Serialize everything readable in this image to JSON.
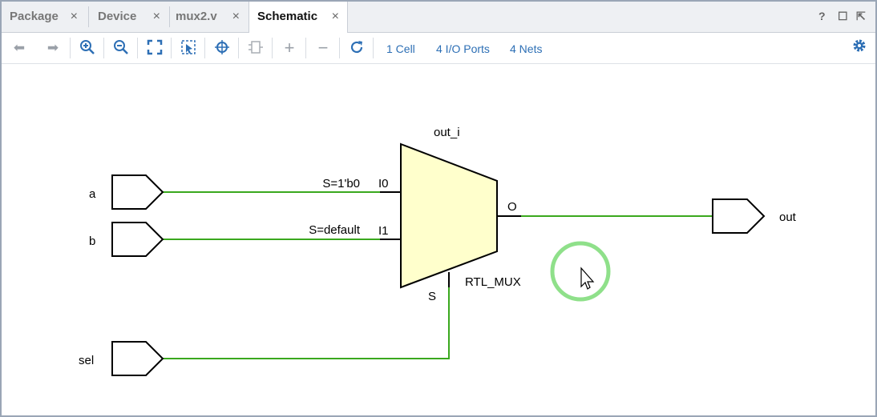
{
  "tabs": [
    {
      "label": "Package",
      "close": "×"
    },
    {
      "label": "Device",
      "close": "×"
    },
    {
      "label": "mux2.v",
      "close": "×"
    },
    {
      "label": "Schematic",
      "close": "×"
    }
  ],
  "active_tab": "Schematic",
  "window_controls": {
    "help": "?",
    "restore": "☐",
    "float": "⇱"
  },
  "toolbar": {
    "icons": [
      "back-arrow-icon",
      "forward-arrow-icon",
      "zoom-in-icon",
      "zoom-out-icon",
      "fit-view-icon",
      "zoom-area-icon",
      "select-icon",
      "autoroute-icon",
      "expand-icon",
      "collapse-icon",
      "refresh-icon"
    ],
    "cells": "1 Cell",
    "io_ports": "4 I/O Ports",
    "nets": "4 Nets"
  },
  "schematic": {
    "instance_name": "out_i",
    "cell_type": "RTL_MUX",
    "pins": {
      "i0": "I0",
      "i1": "I1",
      "o": "O",
      "s": "S"
    },
    "conditions": {
      "i0": "S=1'b0",
      "i1": "S=default"
    },
    "ports": {
      "a": "a",
      "b": "b",
      "sel": "sel",
      "out": "out"
    },
    "colors": {
      "wire": "#3aa81e",
      "mux_fill": "#ffffcc",
      "cursor_ring": "#8fe08a"
    }
  }
}
